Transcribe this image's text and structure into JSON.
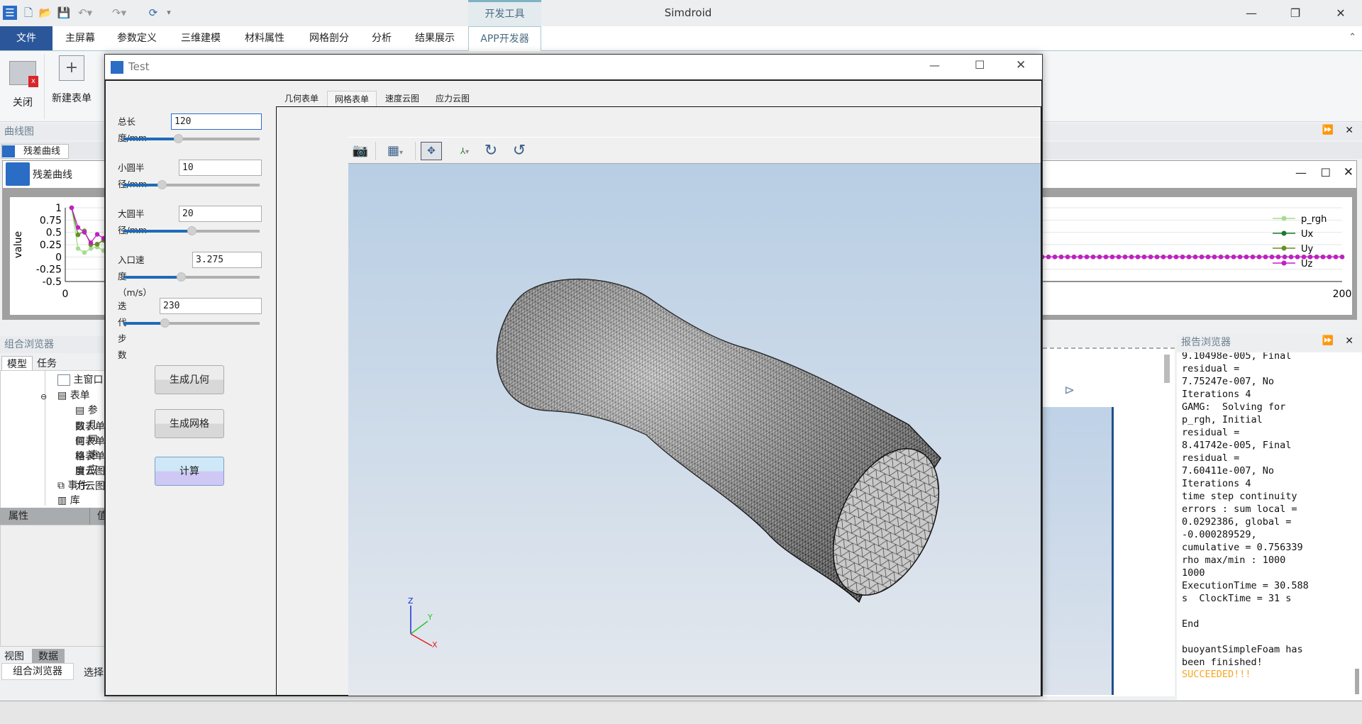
{
  "app": {
    "title": "Simdroid",
    "context_tab": "开发工具"
  },
  "quick_access": [
    "app-logo-icon",
    "new-file-icon",
    "open-folder-icon",
    "save-icon",
    "undo-icon",
    "redo-icon",
    "refresh-icon",
    "customize-icon"
  ],
  "menu": {
    "file": "文件",
    "items": [
      "主屏幕",
      "参数定义",
      "三维建模",
      "材料属性",
      "网格剖分",
      "分析",
      "结果展示",
      "APP开发器"
    ],
    "active": "APP开发器"
  },
  "ribbon": {
    "close": "关闭",
    "new_form": "新建表单"
  },
  "curve_panel": {
    "header": "曲线图",
    "tab": "残差曲线",
    "window_title": "残差曲线"
  },
  "chart_data": {
    "type": "line",
    "xlabel": "",
    "ylabel": "value",
    "xlim": [
      0,
      200
    ],
    "ylim": [
      -0.5,
      1
    ],
    "x_ticks": [
      "0",
      "200"
    ],
    "y_ticks": [
      "1",
      "0.75",
      "0.5",
      "0.25",
      "0",
      "-0.25",
      "-0.5"
    ],
    "legend": "right",
    "grid": true,
    "x_start": 1,
    "series": [
      {
        "name": "p_rgh",
        "color": "#a6dc8f",
        "values": [
          1,
          0.17,
          0.09,
          0.17,
          0.2,
          0.13,
          0,
          0,
          0,
          0
        ]
      },
      {
        "name": "Ux",
        "color": "#1d7a2c",
        "values": [
          1,
          0.45,
          0.53,
          0.25,
          0.26,
          0.34,
          0,
          0,
          0,
          0
        ]
      },
      {
        "name": "Uy",
        "color": "#6b8e23",
        "values": [
          1,
          0.45,
          0.53,
          0.25,
          0.26,
          0.34,
          0,
          0,
          0,
          0
        ]
      },
      {
        "name": "Uz",
        "color": "#c21ec8",
        "values": [
          1,
          0.6,
          0.5,
          0.29,
          0.46,
          0.38,
          0,
          0,
          0,
          0
        ]
      }
    ],
    "tail_value": 0
  },
  "combo_browser": {
    "header": "组合浏览器",
    "tabs": [
      "模型",
      "任务"
    ],
    "tree": [
      "主窗口",
      "表单",
      "参数表单",
      "几何表单",
      "网格表单",
      "速度云图",
      "应力云图",
      "事件",
      "库"
    ],
    "props_cols": [
      "属性",
      "值"
    ],
    "view_tabs": [
      "视图",
      "数据"
    ],
    "bottom_tabs": [
      "组合浏览器",
      "选择"
    ]
  },
  "dialog": {
    "title": "Test",
    "fields": [
      {
        "label": "总长度/mm",
        "value": "120",
        "slider": 0.4
      },
      {
        "label": "小圆半径/mm",
        "value": "10",
        "slider": 0.28
      },
      {
        "label": "大圆半径/mm",
        "value": "20",
        "slider": 0.5
      },
      {
        "label": "入口速度（m/s）",
        "value": "3.275",
        "slider": 0.42
      },
      {
        "label": "迭代步数",
        "value": "230",
        "slider": 0.3
      }
    ],
    "buttons": [
      "生成几何",
      "生成网格",
      "计算"
    ],
    "tabs": [
      "几何表单",
      "网格表单",
      "速度云图",
      "应力云图"
    ],
    "active_tab": "网格表单",
    "viewer_tools": [
      "camera-icon",
      "view-cube-icon",
      "fit-all-icon",
      "axes-icon",
      "rotate-cw-icon",
      "rotate-ccw-icon"
    ],
    "axes": {
      "x": "X",
      "y": "Y",
      "z": "Z"
    }
  },
  "report": {
    "header": "报告浏览器",
    "lines": [
      "9.10498e-005, Final",
      "residual =",
      "7.75247e-007, No",
      "Iterations 4",
      "GAMG:  Solving for",
      "p_rgh, Initial",
      "residual =",
      "8.41742e-005, Final",
      "residual =",
      "7.60411e-007, No",
      "Iterations 4",
      "time step continuity",
      "errors : sum local =",
      "0.0292386, global =",
      "-0.000289529,",
      "cumulative = 0.756339",
      "rho max/min : 1000",
      "1000",
      "ExecutionTime = 30.588",
      "s  ClockTime = 31 s",
      "",
      "End",
      "",
      "buoyantSimpleFoam has",
      "been finished!"
    ],
    "status": "SUCCEEDED!!!",
    "status_color": "#f5a623"
  }
}
